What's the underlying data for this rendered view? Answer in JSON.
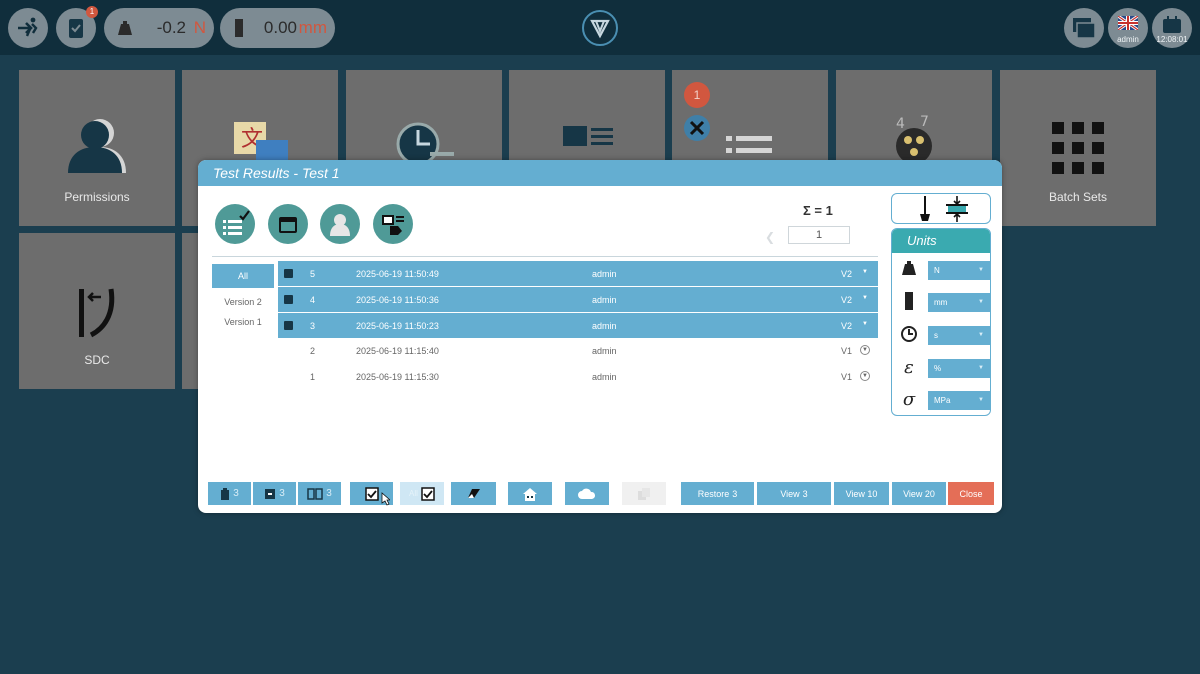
{
  "topbar": {
    "force_value": "-0.2",
    "force_unit": "N",
    "position_value": "0.00",
    "position_unit": "mm",
    "usb_badge": "1",
    "user_label": "admin",
    "time_label": "12:08:01"
  },
  "tiles": [
    {
      "label": "Permissions",
      "icon": "users-icon"
    },
    {
      "label": "",
      "icon": "translate-icon"
    },
    {
      "label": "",
      "icon": "clock-list-icon"
    },
    {
      "label": "",
      "icon": "image-text-icon"
    },
    {
      "label": "",
      "icon": "tools-list-icon",
      "badge": "1"
    },
    {
      "label": "",
      "icon": "film-reel-icon"
    },
    {
      "label": "Batch Sets",
      "icon": "grid-icon"
    },
    {
      "label": "SDC",
      "icon": "sdc-icon"
    }
  ],
  "dialog": {
    "title": "Test Results  -  Test 1",
    "sum_label": "Σ = 1",
    "page_value": "1",
    "versions": [
      "All",
      "Version 2",
      "Version 1"
    ],
    "rows": [
      {
        "index": "5",
        "date": "2025-06-19 11:50:49",
        "user": "admin",
        "version": "V2",
        "selected": true
      },
      {
        "index": "4",
        "date": "2025-06-19 11:50:36",
        "user": "admin",
        "version": "V2",
        "selected": true
      },
      {
        "index": "3",
        "date": "2025-06-19 11:50:23",
        "user": "admin",
        "version": "V2",
        "selected": true
      },
      {
        "index": "2",
        "date": "2025-06-19 11:15:40",
        "user": "admin",
        "version": "V1",
        "selected": false
      },
      {
        "index": "1",
        "date": "2025-06-19 11:15:30",
        "user": "admin",
        "version": "V1",
        "selected": false
      }
    ],
    "units_title": "Units",
    "units": [
      {
        "icon": "weight-icon",
        "value": "N"
      },
      {
        "icon": "length-icon",
        "value": "mm"
      },
      {
        "icon": "clock-icon",
        "value": "s"
      },
      {
        "icon": "epsilon-icon",
        "value": "%"
      },
      {
        "icon": "sigma-icon",
        "value": "MPa"
      }
    ],
    "bottom": {
      "copy_count": "3",
      "archive_count": "3",
      "compare_count": "3",
      "all_label": "All",
      "restore_label": "Restore",
      "restore_count": "3",
      "view_label": "View",
      "view_count": "3",
      "view10_label": "View 10",
      "view20_label": "View 20",
      "close_label": "Close"
    },
    "colors": {
      "accent": "#64aed1",
      "teal": "#4f9a97",
      "close": "#e46e57"
    }
  }
}
